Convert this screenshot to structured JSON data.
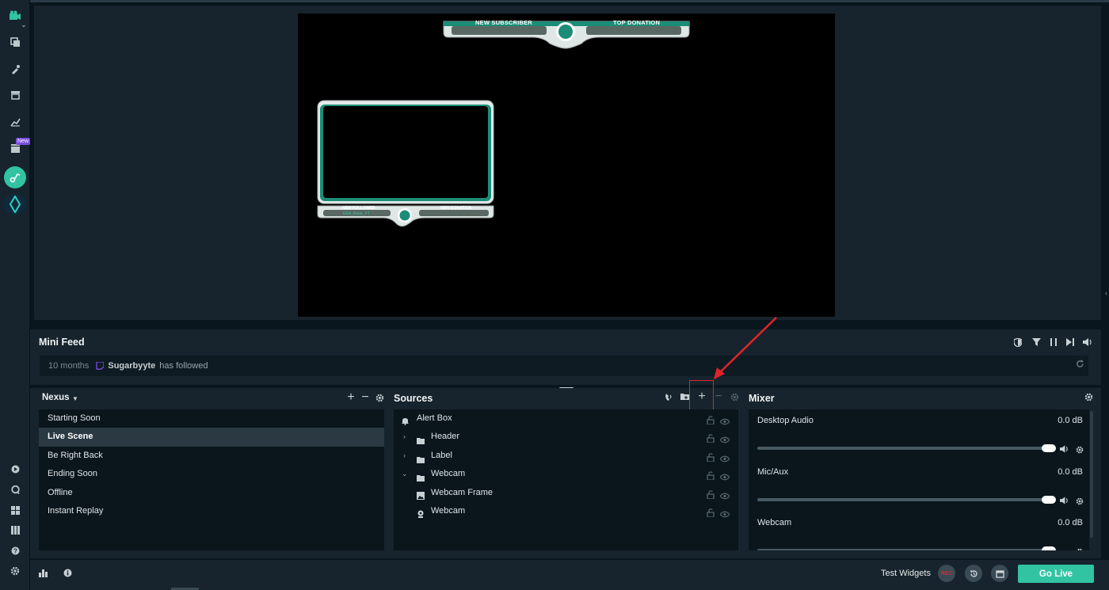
{
  "sidebar": {
    "new_badge": "New"
  },
  "preview": {
    "overlay_top_left": "NEW SUBSCRIBER",
    "overlay_top_right": "TOP DONATION",
    "overlay_bottom_left": "NEW FOLLOWER",
    "overlay_bottom_right": "NEW DONATION",
    "overlay_follower_name": "ERA_Badx_YT"
  },
  "minifeed": {
    "title": "Mini Feed",
    "items": [
      {
        "time": "10 months",
        "user": "Sugarbyyte",
        "action": "has followed"
      }
    ]
  },
  "scenes": {
    "collection": "Nexus",
    "items": [
      {
        "label": "Starting Soon",
        "active": false
      },
      {
        "label": "Live Scene",
        "active": true
      },
      {
        "label": "Be Right Back",
        "active": false
      },
      {
        "label": "Ending Soon",
        "active": false
      },
      {
        "label": "Offline",
        "active": false
      },
      {
        "label": "Instant Replay",
        "active": false
      }
    ]
  },
  "sources": {
    "title": "Sources",
    "items": [
      {
        "label": "Alert Box",
        "icon": "bell-icon",
        "expander": ""
      },
      {
        "label": "Header",
        "icon": "folder-icon",
        "expander": "chevron-right-icon"
      },
      {
        "label": "Label",
        "icon": "folder-icon",
        "expander": "chevron-right-icon"
      },
      {
        "label": "Webcam",
        "icon": "folder-icon",
        "expander": "chevron-down-icon"
      },
      {
        "label": "Webcam Frame",
        "icon": "image-icon",
        "expander": ""
      },
      {
        "label": "Webcam",
        "icon": "webcam-icon",
        "expander": ""
      }
    ]
  },
  "mixer": {
    "title": "Mixer",
    "channels": [
      {
        "name": "Desktop Audio",
        "level": "0.0 dB",
        "volume_fraction": 1.0
      },
      {
        "name": "Mic/Aux",
        "level": "0.0 dB",
        "volume_fraction": 1.0
      },
      {
        "name": "Webcam",
        "level": "0.0 dB",
        "volume_fraction": 1.0
      }
    ]
  },
  "footer": {
    "test_widgets": "Test Widgets",
    "rec": "REC",
    "go_live": "Go Live"
  },
  "colors": {
    "accent": "#31c3a2",
    "annotation": "#e0242a",
    "panel": "#17242d",
    "list_bg": "#0a161c"
  }
}
